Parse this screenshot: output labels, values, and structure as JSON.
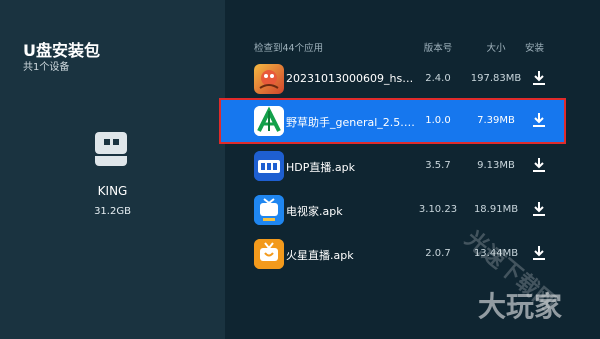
{
  "sidebar": {
    "title": "U盘安装包",
    "subtitle": "共1个设备",
    "device": {
      "name": "KING",
      "size": "31.2GB",
      "icon": "usb-drive-icon"
    }
  },
  "list": {
    "header": {
      "count": "检查到44个应用",
      "version": "版本号",
      "size": "大小",
      "install": "安装"
    },
    "items": [
      {
        "name": "20231013000609_hsahc_...",
        "version": "2.4.0",
        "size": "197.83MB",
        "icon": "game-app-icon"
      },
      {
        "name": "野草助手_general_2.5.110...",
        "version": "1.0.0",
        "size": "7.39MB",
        "icon": "yecao-app-icon"
      },
      {
        "name": "HDP直播.apk",
        "version": "3.5.7",
        "size": "9.13MB",
        "icon": "hdp-app-icon"
      },
      {
        "name": "电视家.apk",
        "version": "3.10.23",
        "size": "18.91MB",
        "icon": "tvhome-app-icon"
      },
      {
        "name": "火星直播.apk",
        "version": "2.0.7",
        "size": "13.44MB",
        "icon": "mars-app-icon"
      }
    ]
  },
  "watermark": {
    "line1": "光速下载网",
    "line2": "大玩家"
  },
  "colors": {
    "selected": "#1677ee",
    "highlight_border": "#e02b2b",
    "sidebar_bg": "#1a3340",
    "main_bg": "#0f2531"
  }
}
